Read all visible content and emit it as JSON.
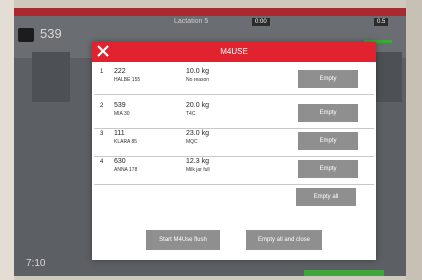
{
  "background": {
    "cow_number": "539",
    "lactation": "Lactation 5",
    "badge_a": "0:00",
    "badge_b": "0.5",
    "time": "7:10"
  },
  "dialog": {
    "title": "M4USE",
    "close_icon": "close-icon",
    "rows": [
      {
        "index": "1",
        "cow": "222",
        "name": "HALBE 155",
        "weight": "10.0 kg",
        "reason": "No reason",
        "button": "Empty"
      },
      {
        "index": "2",
        "cow": "539",
        "name": "MIA 30",
        "weight": "20.0 kg",
        "reason": "T4C",
        "button": "Empty"
      },
      {
        "index": "3",
        "cow": "111",
        "name": "KLARA 85",
        "weight": "23.0 kg",
        "reason": "MQC",
        "button": "Empty"
      },
      {
        "index": "4",
        "cow": "630",
        "name": "ANNA 178",
        "weight": "12.3 kg",
        "reason": "Milk jar full",
        "button": "Empty"
      }
    ],
    "empty_all_label": "Empty all",
    "start_flush_label": "Start M4Use flush",
    "empty_all_close_label": "Empty all and close"
  },
  "colors": {
    "header_red": "#e0232f",
    "button_gray": "#8f8f8f"
  }
}
